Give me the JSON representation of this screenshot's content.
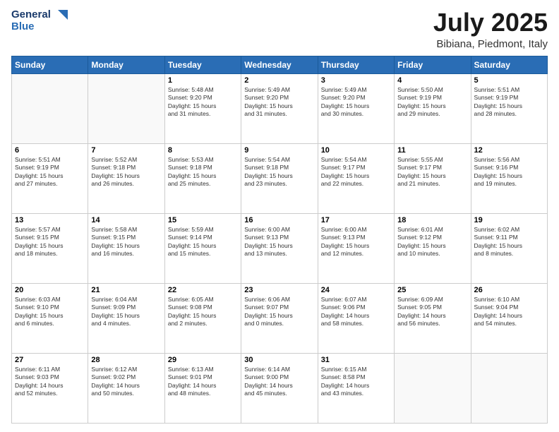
{
  "logo": {
    "line1": "General",
    "line2": "Blue"
  },
  "title": "July 2025",
  "location": "Bibiana, Piedmont, Italy",
  "headers": [
    "Sunday",
    "Monday",
    "Tuesday",
    "Wednesday",
    "Thursday",
    "Friday",
    "Saturday"
  ],
  "weeks": [
    [
      {
        "day": "",
        "info": ""
      },
      {
        "day": "",
        "info": ""
      },
      {
        "day": "1",
        "info": "Sunrise: 5:48 AM\nSunset: 9:20 PM\nDaylight: 15 hours\nand 31 minutes."
      },
      {
        "day": "2",
        "info": "Sunrise: 5:49 AM\nSunset: 9:20 PM\nDaylight: 15 hours\nand 31 minutes."
      },
      {
        "day": "3",
        "info": "Sunrise: 5:49 AM\nSunset: 9:20 PM\nDaylight: 15 hours\nand 30 minutes."
      },
      {
        "day": "4",
        "info": "Sunrise: 5:50 AM\nSunset: 9:19 PM\nDaylight: 15 hours\nand 29 minutes."
      },
      {
        "day": "5",
        "info": "Sunrise: 5:51 AM\nSunset: 9:19 PM\nDaylight: 15 hours\nand 28 minutes."
      }
    ],
    [
      {
        "day": "6",
        "info": "Sunrise: 5:51 AM\nSunset: 9:19 PM\nDaylight: 15 hours\nand 27 minutes."
      },
      {
        "day": "7",
        "info": "Sunrise: 5:52 AM\nSunset: 9:18 PM\nDaylight: 15 hours\nand 26 minutes."
      },
      {
        "day": "8",
        "info": "Sunrise: 5:53 AM\nSunset: 9:18 PM\nDaylight: 15 hours\nand 25 minutes."
      },
      {
        "day": "9",
        "info": "Sunrise: 5:54 AM\nSunset: 9:18 PM\nDaylight: 15 hours\nand 23 minutes."
      },
      {
        "day": "10",
        "info": "Sunrise: 5:54 AM\nSunset: 9:17 PM\nDaylight: 15 hours\nand 22 minutes."
      },
      {
        "day": "11",
        "info": "Sunrise: 5:55 AM\nSunset: 9:17 PM\nDaylight: 15 hours\nand 21 minutes."
      },
      {
        "day": "12",
        "info": "Sunrise: 5:56 AM\nSunset: 9:16 PM\nDaylight: 15 hours\nand 19 minutes."
      }
    ],
    [
      {
        "day": "13",
        "info": "Sunrise: 5:57 AM\nSunset: 9:15 PM\nDaylight: 15 hours\nand 18 minutes."
      },
      {
        "day": "14",
        "info": "Sunrise: 5:58 AM\nSunset: 9:15 PM\nDaylight: 15 hours\nand 16 minutes."
      },
      {
        "day": "15",
        "info": "Sunrise: 5:59 AM\nSunset: 9:14 PM\nDaylight: 15 hours\nand 15 minutes."
      },
      {
        "day": "16",
        "info": "Sunrise: 6:00 AM\nSunset: 9:13 PM\nDaylight: 15 hours\nand 13 minutes."
      },
      {
        "day": "17",
        "info": "Sunrise: 6:00 AM\nSunset: 9:13 PM\nDaylight: 15 hours\nand 12 minutes."
      },
      {
        "day": "18",
        "info": "Sunrise: 6:01 AM\nSunset: 9:12 PM\nDaylight: 15 hours\nand 10 minutes."
      },
      {
        "day": "19",
        "info": "Sunrise: 6:02 AM\nSunset: 9:11 PM\nDaylight: 15 hours\nand 8 minutes."
      }
    ],
    [
      {
        "day": "20",
        "info": "Sunrise: 6:03 AM\nSunset: 9:10 PM\nDaylight: 15 hours\nand 6 minutes."
      },
      {
        "day": "21",
        "info": "Sunrise: 6:04 AM\nSunset: 9:09 PM\nDaylight: 15 hours\nand 4 minutes."
      },
      {
        "day": "22",
        "info": "Sunrise: 6:05 AM\nSunset: 9:08 PM\nDaylight: 15 hours\nand 2 minutes."
      },
      {
        "day": "23",
        "info": "Sunrise: 6:06 AM\nSunset: 9:07 PM\nDaylight: 15 hours\nand 0 minutes."
      },
      {
        "day": "24",
        "info": "Sunrise: 6:07 AM\nSunset: 9:06 PM\nDaylight: 14 hours\nand 58 minutes."
      },
      {
        "day": "25",
        "info": "Sunrise: 6:09 AM\nSunset: 9:05 PM\nDaylight: 14 hours\nand 56 minutes."
      },
      {
        "day": "26",
        "info": "Sunrise: 6:10 AM\nSunset: 9:04 PM\nDaylight: 14 hours\nand 54 minutes."
      }
    ],
    [
      {
        "day": "27",
        "info": "Sunrise: 6:11 AM\nSunset: 9:03 PM\nDaylight: 14 hours\nand 52 minutes."
      },
      {
        "day": "28",
        "info": "Sunrise: 6:12 AM\nSunset: 9:02 PM\nDaylight: 14 hours\nand 50 minutes."
      },
      {
        "day": "29",
        "info": "Sunrise: 6:13 AM\nSunset: 9:01 PM\nDaylight: 14 hours\nand 48 minutes."
      },
      {
        "day": "30",
        "info": "Sunrise: 6:14 AM\nSunset: 9:00 PM\nDaylight: 14 hours\nand 45 minutes."
      },
      {
        "day": "31",
        "info": "Sunrise: 6:15 AM\nSunset: 8:58 PM\nDaylight: 14 hours\nand 43 minutes."
      },
      {
        "day": "",
        "info": ""
      },
      {
        "day": "",
        "info": ""
      }
    ]
  ]
}
